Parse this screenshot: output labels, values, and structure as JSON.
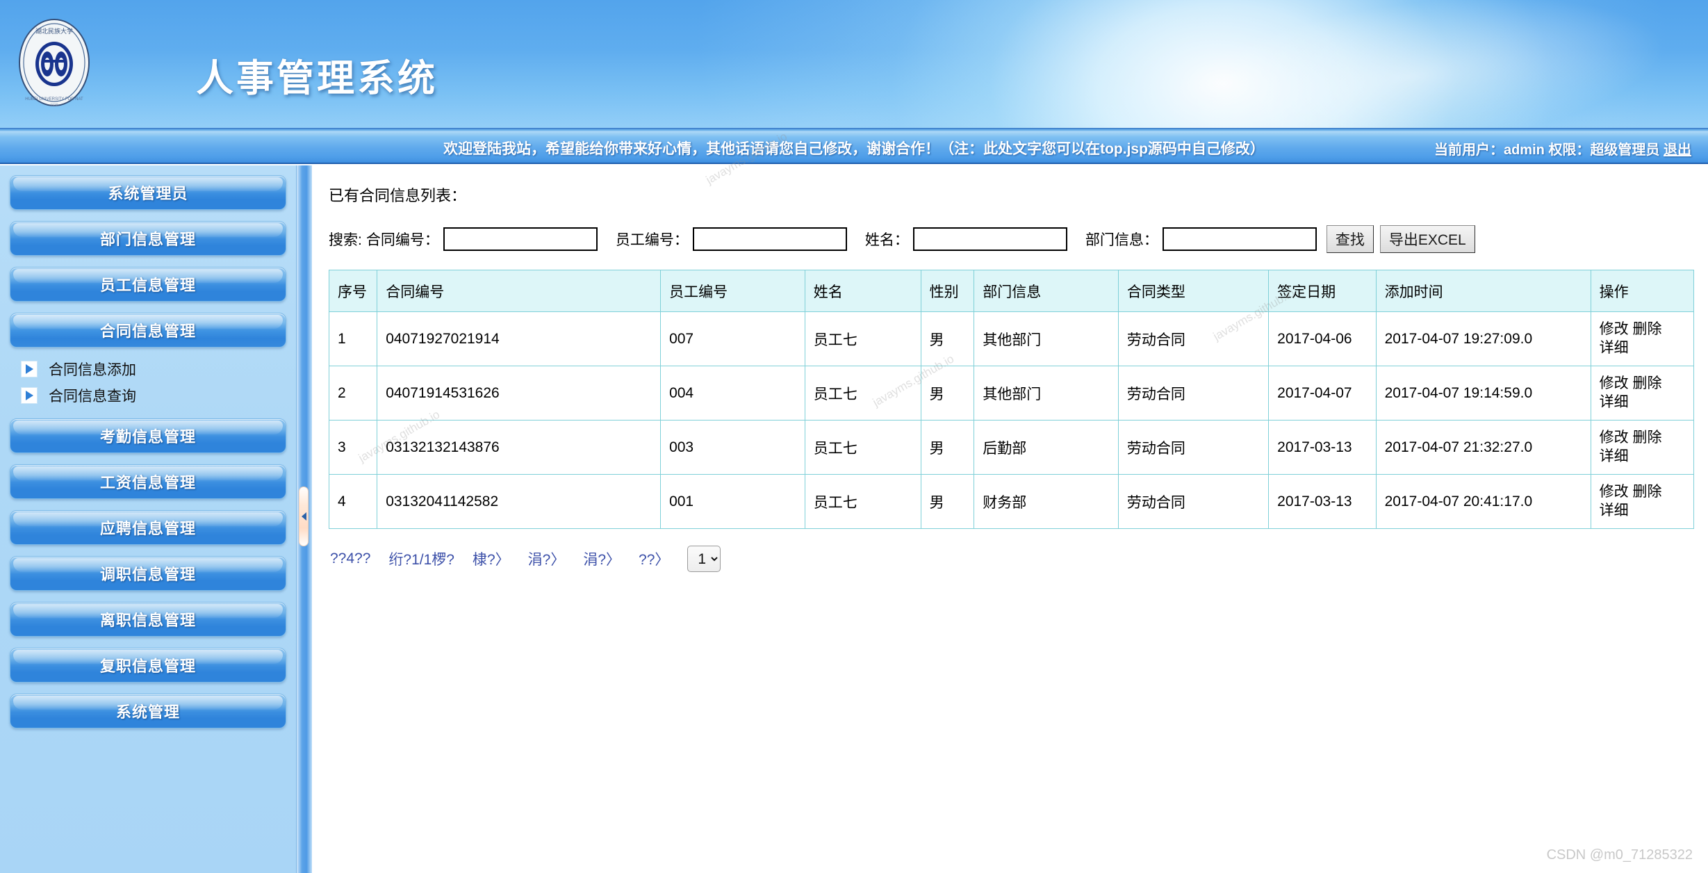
{
  "banner": {
    "title": "人事管理系统",
    "logo_name": "university-seal-logo"
  },
  "topbar": {
    "welcome": "欢迎登陆我站，希望能给你带来好心情，其他话语请您自己修改，谢谢合作！（注：此处文字您可以在top.jsp源码中自己修改）",
    "user_prefix": "当前用户：",
    "user": "admin",
    "role_prefix": "权限：",
    "role": "超级管理员",
    "logout": "退出"
  },
  "sidebar": {
    "items": [
      {
        "label": "系统管理员",
        "active": false
      },
      {
        "label": "部门信息管理",
        "active": false
      },
      {
        "label": "员工信息管理",
        "active": false
      },
      {
        "label": "合同信息管理",
        "active": true
      },
      {
        "label": "考勤信息管理",
        "active": false
      },
      {
        "label": "工资信息管理",
        "active": false
      },
      {
        "label": "应聘信息管理",
        "active": false
      },
      {
        "label": "调职信息管理",
        "active": false
      },
      {
        "label": "离职信息管理",
        "active": false
      },
      {
        "label": "复职信息管理",
        "active": false
      },
      {
        "label": "系统管理",
        "active": false
      }
    ],
    "submenu": [
      {
        "label": "合同信息添加"
      },
      {
        "label": "合同信息查询"
      }
    ],
    "submenu_after_index": 3
  },
  "main": {
    "page_title": "已有合同信息列表：",
    "search": {
      "prefix": "搜索:",
      "fields": [
        {
          "label": "合同编号：",
          "value": "",
          "placeholder": ""
        },
        {
          "label": "员工编号：",
          "value": "",
          "placeholder": ""
        },
        {
          "label": "姓名：",
          "value": "",
          "placeholder": ""
        },
        {
          "label": "部门信息：",
          "value": "",
          "placeholder": ""
        }
      ],
      "search_button": "查找",
      "export_button": "导出EXCEL"
    },
    "table": {
      "headers": [
        "序号",
        "合同编号",
        "员工编号",
        "姓名",
        "性别",
        "部门信息",
        "合同类型",
        "签定日期",
        "添加时间",
        "操作"
      ],
      "rows": [
        {
          "index": "1",
          "contract_no": "04071927021914",
          "employee_no": "007",
          "name": "员工七",
          "gender": "男",
          "department": "其他部门",
          "contract_type": "劳动合同",
          "sign_date": "2017-04-06",
          "add_time": "2017-04-07 19:27:09.0",
          "ops": [
            "修改",
            "删除",
            "详细"
          ]
        },
        {
          "index": "2",
          "contract_no": "04071914531626",
          "employee_no": "004",
          "name": "员工七",
          "gender": "男",
          "department": "其他部门",
          "contract_type": "劳动合同",
          "sign_date": "2017-04-07",
          "add_time": "2017-04-07 19:14:59.0",
          "ops": [
            "修改",
            "删除",
            "详细"
          ]
        },
        {
          "index": "3",
          "contract_no": "03132132143876",
          "employee_no": "003",
          "name": "员工七",
          "gender": "男",
          "department": "后勤部",
          "contract_type": "劳动合同",
          "sign_date": "2017-03-13",
          "add_time": "2017-04-07 21:32:27.0",
          "ops": [
            "修改",
            "删除",
            "详细"
          ]
        },
        {
          "index": "4",
          "contract_no": "03132041142582",
          "employee_no": "001",
          "name": "员工七",
          "gender": "男",
          "department": "财务部",
          "contract_type": "劳动合同",
          "sign_date": "2017-03-13",
          "add_time": "2017-04-07 20:41:17.0",
          "ops": [
            "修改",
            "删除",
            "详细"
          ]
        }
      ]
    },
    "pager": {
      "total": "??4??",
      "pages": "绗?1/1椤?",
      "first": "棣?〉",
      "prev": "涓?〉",
      "next": "涓?〉",
      "last": "??〉",
      "page_select_value": "1",
      "page_select_options": [
        "1"
      ]
    }
  },
  "watermarks": {
    "tiles": [
      "javayms.github.io",
      "javayms.github.io",
      "javayms.github.io",
      "javayms.github.io"
    ],
    "csdn": "CSDN @m0_71285322"
  }
}
